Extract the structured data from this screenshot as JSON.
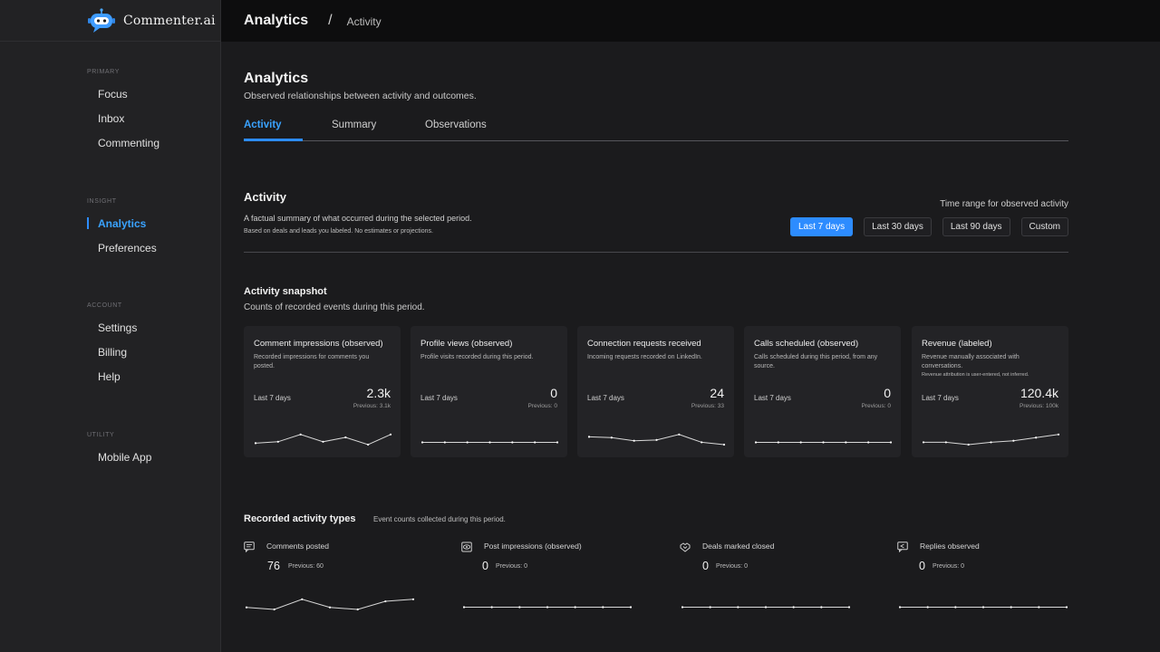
{
  "app": {
    "name": "Commenter.ai",
    "logo_icon": "robot-chat-icon"
  },
  "breadcrumb": {
    "main": "Analytics",
    "separator": "/",
    "sub": "Activity"
  },
  "sidebar": {
    "sections": [
      {
        "heading": "PRIMARY",
        "items": [
          "Focus",
          "Inbox",
          "Commenting"
        ]
      },
      {
        "heading": "INSIGHT",
        "items": [
          "Analytics",
          "Preferences"
        ],
        "active_index": 0
      },
      {
        "heading": "ACCOUNT",
        "items": [
          "Settings",
          "Billing",
          "Help"
        ]
      },
      {
        "heading": "UTILITY",
        "items": [
          "Mobile App"
        ]
      }
    ]
  },
  "page": {
    "title": "Analytics",
    "subtitle": "Observed relationships between activity and outcomes.",
    "tabs": [
      "Activity",
      "Summary",
      "Observations"
    ],
    "active_tab": 0
  },
  "activity": {
    "title": "Activity",
    "description": "A factual summary of what occurred during the selected period.",
    "note": "Based on deals and leads you labeled. No estimates or projections.",
    "range_label": "Time range for observed activity",
    "ranges": [
      "Last 7 days",
      "Last 30 days",
      "Last 90 days",
      "Custom"
    ],
    "active_range": 0
  },
  "snapshot": {
    "title": "Activity snapshot",
    "description": "Counts of recorded events during this period.",
    "cards": [
      {
        "title": "Comment impressions (observed)",
        "desc": "Recorded impressions for comments you posted.",
        "range": "Last 7 days",
        "value": "2.3k",
        "previous": "Previous: 3.1k",
        "trend": [
          2,
          3,
          8,
          3,
          6,
          1,
          8
        ]
      },
      {
        "title": "Profile views (observed)",
        "desc": "Profile visits recorded during this period.",
        "range": "Last 7 days",
        "value": "0",
        "previous": "Previous: 0",
        "trend": [
          0,
          0,
          0,
          0,
          0,
          0,
          0
        ]
      },
      {
        "title": "Connection requests received",
        "desc": "Incoming requests recorded on LinkedIn.",
        "range": "Last 7 days",
        "value": "24",
        "previous": "Previous: 33",
        "trend": [
          6,
          5.5,
          3.5,
          4,
          7.5,
          2.5,
          1
        ]
      },
      {
        "title": "Calls scheduled (observed)",
        "desc": "Calls scheduled during this period, from any source.",
        "range": "Last 7 days",
        "value": "0",
        "previous": "Previous: 0",
        "trend": [
          0,
          0,
          0,
          0,
          0,
          0,
          0
        ]
      },
      {
        "title": "Revenue (labeled)",
        "desc": "Revenue manually associated with conversations.",
        "desc2": "Revenue attribution is user-entered, not inferred.",
        "range": "Last 7 days",
        "value": "120.4k",
        "previous": "Previous: 100k",
        "trend": [
          3,
          3,
          1.5,
          3,
          4,
          6,
          8
        ]
      }
    ]
  },
  "recorded": {
    "title": "Recorded activity types",
    "description": "Event counts collected during this period.",
    "types": [
      {
        "icon": "comment-icon",
        "label": "Comments posted",
        "value": "76",
        "previous": "Previous: 60",
        "trend": [
          3,
          2,
          7,
          3,
          2,
          6,
          7
        ]
      },
      {
        "icon": "impressions-icon",
        "label": "Post impressions (observed)",
        "value": "0",
        "previous": "Previous: 0",
        "trend": [
          0,
          0,
          0,
          0,
          0,
          0,
          0
        ]
      },
      {
        "icon": "handshake-icon",
        "label": "Deals marked closed",
        "value": "0",
        "previous": "Previous: 0",
        "trend": [
          0,
          0,
          0,
          0,
          0,
          0,
          0
        ]
      },
      {
        "icon": "reply-icon",
        "label": "Replies observed",
        "value": "0",
        "previous": "Previous: 0",
        "trend": [
          0,
          0,
          0,
          0,
          0,
          0,
          0
        ]
      }
    ]
  }
}
